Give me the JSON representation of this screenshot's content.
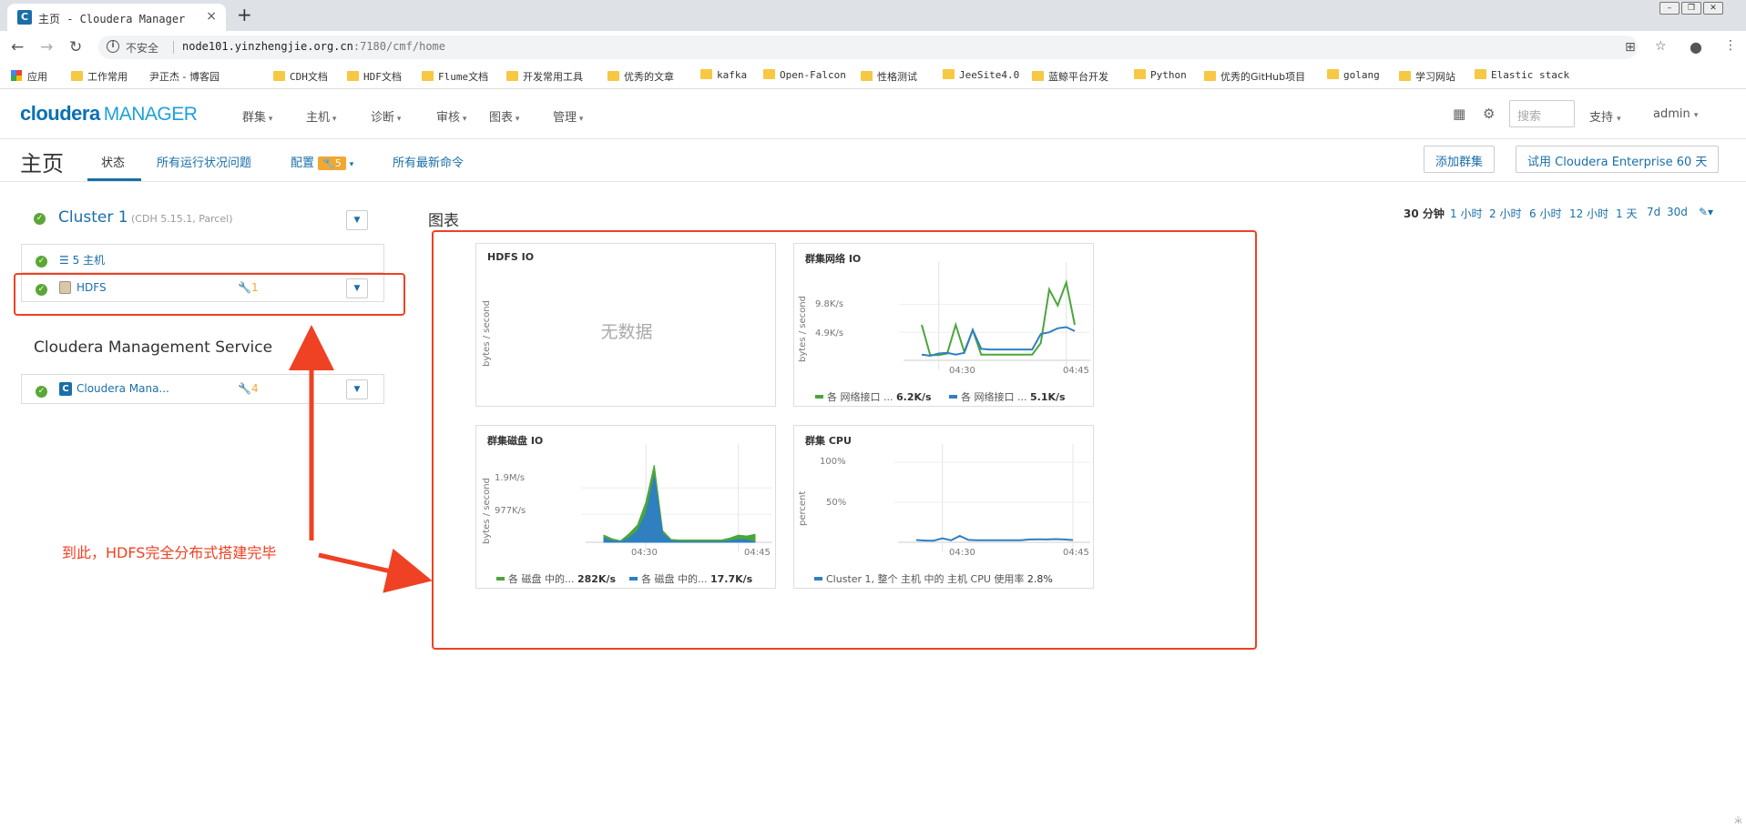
{
  "browser": {
    "tab_title": "主页 - Cloudera Manager",
    "favicon_letter": "C",
    "url_host": "node101.yinzhengjie.org.cn",
    "url_rest": ":7180/cmf/home",
    "insecure_label": "不安全",
    "new_tab": "+",
    "close": "×"
  },
  "bookmarks": [
    "应用",
    "工作常用",
    "尹正杰 - 博客园",
    "CDH文档",
    "HDF文档",
    "Flume文档",
    "开发常用工具",
    "优秀的文章",
    "kafka",
    "Open-Falcon",
    "性格测试",
    "JeeSite4.0",
    "蓝鲸平台开发",
    "Python",
    "优秀的GitHub项目",
    "golang",
    "学习网站",
    "Elastic stack"
  ],
  "app": {
    "logo_main": "cloudera",
    "logo_sub": "MANAGER",
    "menu": [
      "群集",
      "主机",
      "诊断",
      "审核",
      "图表",
      "管理"
    ],
    "search_placeholder": "搜索",
    "support": "支持",
    "user": "admin"
  },
  "subnav": {
    "title": "主页",
    "tabs": [
      "状态",
      "所有运行状况问题",
      "配置",
      "所有最新命令"
    ],
    "config_badge": "5",
    "add_cluster": "添加群集",
    "trial": "试用 Cloudera Enterprise 60 天"
  },
  "cluster": {
    "name": "Cluster 1",
    "version": "(CDH 5.15.1, Parcel)",
    "hosts": "5 主机",
    "hdfs": "HDFS",
    "hdfs_warnings": "1"
  },
  "cms": {
    "title": "Cloudera Management Service",
    "name": "Cloudera Mana...",
    "warnings": "4"
  },
  "annotation": "到此，HDFS完全分布式搭建完毕",
  "charts_section": {
    "title": "图表",
    "ranges": [
      "30 分钟",
      "1 小时",
      "2 小时",
      "6 小时",
      "12 小时",
      "1 天",
      "7d",
      "30d"
    ],
    "active_range": "30 分钟"
  },
  "charts": {
    "hdfs_io": {
      "title": "HDFS IO",
      "ylabel": "bytes / second",
      "nodata": "无数据"
    },
    "net_io": {
      "title": "群集网络 IO",
      "ylabel": "bytes / second",
      "yticks": [
        "9.8K/s",
        "4.9K/s"
      ],
      "xticks": [
        "04:30",
        "04:45"
      ],
      "legend": [
        {
          "label": "各 网络接口 ...",
          "value": "6.2K/s",
          "color": "#4aa63a"
        },
        {
          "label": "各 网络接口 ...",
          "value": "5.1K/s",
          "color": "#2f7fc1"
        }
      ]
    },
    "disk_io": {
      "title": "群集磁盘 IO",
      "ylabel": "bytes / second",
      "yticks": [
        "1.9M/s",
        "977K/s"
      ],
      "xticks": [
        "04:30",
        "04:45"
      ],
      "legend": [
        {
          "label": "各 磁盘 中的...",
          "value": "282K/s",
          "color": "#4aa63a"
        },
        {
          "label": "各 磁盘 中的...",
          "value": "17.7K/s",
          "color": "#2f7fc1"
        }
      ]
    },
    "cpu": {
      "title": "群集 CPU",
      "ylabel": "percent",
      "yticks": [
        "100%",
        "50%"
      ],
      "xticks": [
        "04:30",
        "04:45"
      ],
      "legend": [
        {
          "label": "Cluster 1, 整个 主机 中的 主机 CPU 使用率",
          "value": "2.8%",
          "color": "#2f7fc1"
        }
      ]
    }
  },
  "chart_data": [
    {
      "type": "line",
      "title": "群集网络 IO",
      "xlabel": "",
      "ylabel": "bytes / second",
      "x": [
        "04:28",
        "04:29",
        "04:30",
        "04:31",
        "04:32",
        "04:33",
        "04:34",
        "04:35",
        "04:36",
        "04:37",
        "04:38",
        "04:39",
        "04:40",
        "04:41",
        "04:42",
        "04:43",
        "04:44",
        "04:45",
        "04:46"
      ],
      "series": [
        {
          "name": "各 网络接口 ...",
          "values": [
            6.2,
            0.9,
            0.9,
            1.2,
            6.2,
            1.5,
            5.3,
            1.0,
            1.0,
            1.0,
            1.0,
            1.0,
            1.0,
            1.0,
            3.0,
            12.4,
            9.6,
            13.6,
            6.2
          ]
        },
        {
          "name": "各 网络接口 ...",
          "values": [
            1.0,
            0.8,
            1.2,
            1.3,
            1.0,
            1.3,
            5.3,
            2.0,
            1.9,
            1.9,
            1.9,
            1.9,
            1.9,
            1.9,
            4.6,
            4.9,
            5.6,
            5.8,
            5.1
          ]
        }
      ],
      "ylim": [
        0,
        14
      ]
    },
    {
      "type": "area",
      "title": "群集磁盘 IO",
      "xlabel": "",
      "ylabel": "bytes / second",
      "x": [
        "04:27",
        "04:28",
        "04:29",
        "04:30",
        "04:31",
        "04:32",
        "04:33",
        "04:34",
        "04:35",
        "04:36",
        "04:37",
        "04:38",
        "04:39",
        "04:40",
        "04:41",
        "04:42",
        "04:43",
        "04:44",
        "04:45"
      ],
      "series": [
        {
          "name": "各 磁盘 中的...",
          "values": [
            0.25,
            0.12,
            0.05,
            0.3,
            0.6,
            1.4,
            2.7,
            0.4,
            0.1,
            0.08,
            0.08,
            0.08,
            0.08,
            0.08,
            0.08,
            0.15,
            0.25,
            0.22,
            0.28
          ]
        },
        {
          "name": "各 磁盘 中的...",
          "values": [
            0.15,
            0.05,
            0.02,
            0.15,
            0.4,
            1.0,
            2.3,
            0.3,
            0.05,
            0.02,
            0.02,
            0.02,
            0.02,
            0.02,
            0.02,
            0.05,
            0.1,
            0.08,
            0.02
          ]
        }
      ],
      "ylim": [
        0,
        2.8
      ]
    },
    {
      "type": "line",
      "title": "群集 CPU",
      "xlabel": "",
      "ylabel": "percent",
      "x": [
        "04:27",
        "04:28",
        "04:29",
        "04:30",
        "04:31",
        "04:32",
        "04:33",
        "04:34",
        "04:35",
        "04:36",
        "04:37",
        "04:38",
        "04:39",
        "04:40",
        "04:41",
        "04:42",
        "04:43",
        "04:44",
        "04:45"
      ],
      "series": [
        {
          "name": "Cluster 1, 整个 主机 中的 主机 CPU 使用率",
          "values": [
            2.8,
            2.2,
            2.0,
            5.0,
            2.5,
            8.0,
            3.0,
            2.5,
            2.5,
            2.5,
            2.5,
            2.5,
            2.5,
            3.5,
            3.8,
            3.5,
            4.0,
            3.5,
            2.8
          ]
        }
      ],
      "ylim": [
        0,
        100
      ]
    }
  ],
  "colors": {
    "accent": "#1a6fa8",
    "green": "#4aa63a",
    "blue": "#2f7fc1",
    "warning": "#f0a830",
    "annotation": "#ef4123",
    "ok": "#5ba735"
  }
}
